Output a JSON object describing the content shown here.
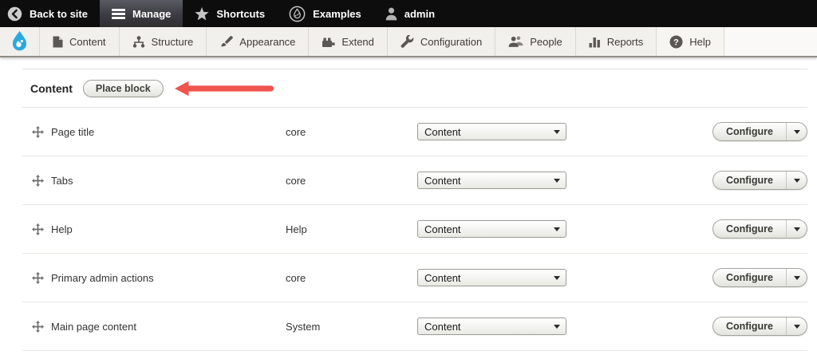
{
  "admin_toolbar": {
    "items": [
      {
        "label": "Back to site",
        "icon": "back-icon"
      },
      {
        "label": "Manage",
        "icon": "hamburger-icon",
        "active": true
      },
      {
        "label": "Shortcuts",
        "icon": "star-icon"
      },
      {
        "label": "Examples",
        "icon": "droplet-outline-icon"
      },
      {
        "label": "admin",
        "icon": "user-icon"
      }
    ]
  },
  "admin_menu": {
    "items": [
      {
        "label": "Content",
        "icon": "file-icon"
      },
      {
        "label": "Structure",
        "icon": "sitemap-icon"
      },
      {
        "label": "Appearance",
        "icon": "paintbrush-icon"
      },
      {
        "label": "Extend",
        "icon": "module-icon"
      },
      {
        "label": "Configuration",
        "icon": "wrench-icon"
      },
      {
        "label": "People",
        "icon": "people-icon"
      },
      {
        "label": "Reports",
        "icon": "bar-chart-icon"
      },
      {
        "label": "Help",
        "icon": "help-circle-icon"
      }
    ]
  },
  "region_header": {
    "title": "Content",
    "place_block_label": "Place block",
    "annotation": "red-arrow-pointing-left"
  },
  "blocks_table": {
    "rows": [
      {
        "label": "Page title",
        "provider": "core",
        "region": "Content",
        "configure_label": "Configure"
      },
      {
        "label": "Tabs",
        "provider": "core",
        "region": "Content",
        "configure_label": "Configure"
      },
      {
        "label": "Help",
        "provider": "Help",
        "region": "Content",
        "configure_label": "Configure"
      },
      {
        "label": "Primary admin actions",
        "provider": "core",
        "region": "Content",
        "configure_label": "Configure"
      },
      {
        "label": "Main page content",
        "provider": "System",
        "region": "Content",
        "configure_label": "Configure"
      }
    ]
  },
  "colors": {
    "toolbar_black": "#0d0d0d",
    "drupal_blue": "#29a8e0",
    "arrow_red": "#f0544c"
  }
}
